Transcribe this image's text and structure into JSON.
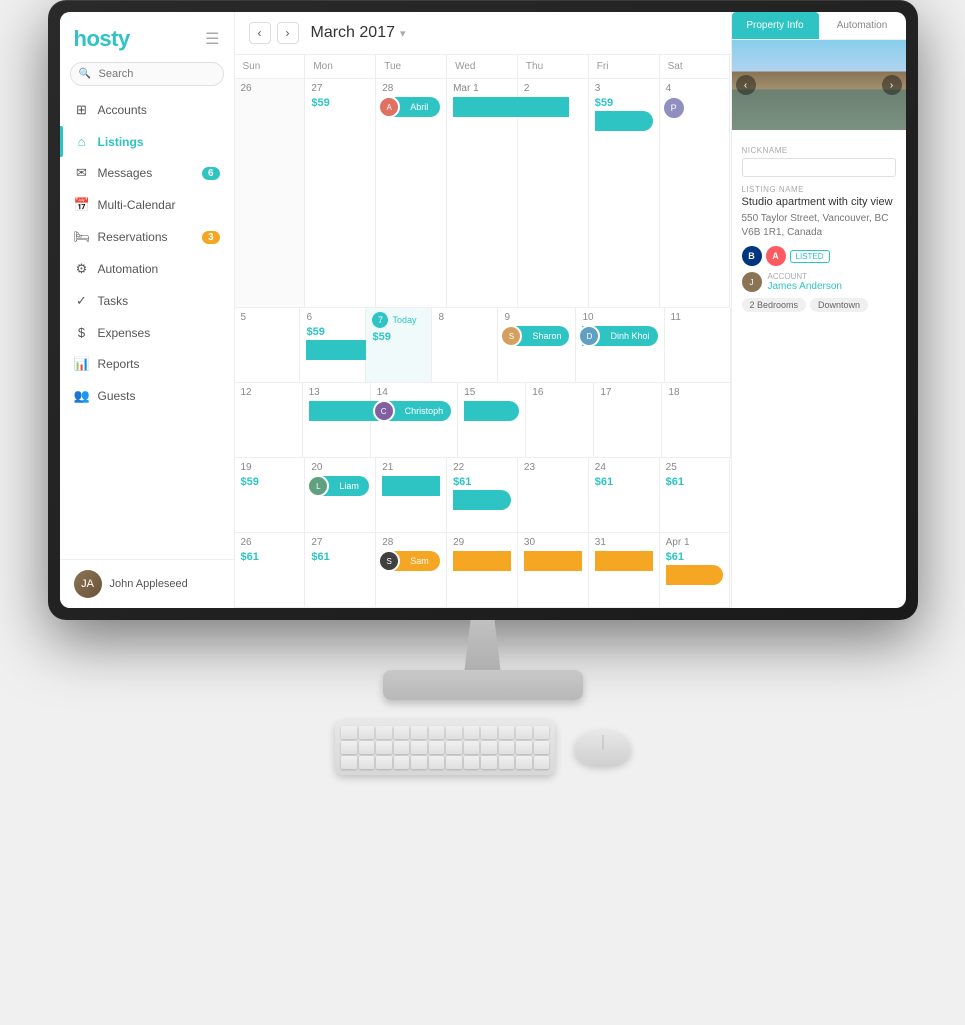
{
  "app": {
    "name": "hosty",
    "title": "Hosty - Property Management"
  },
  "sidebar": {
    "logo": "hosty",
    "search_placeholder": "Search",
    "nav_items": [
      {
        "id": "accounts",
        "label": "Accounts",
        "icon": "accounts",
        "active": false,
        "badge": null
      },
      {
        "id": "listings",
        "label": "Listings",
        "icon": "listings",
        "active": true,
        "badge": null
      },
      {
        "id": "messages",
        "label": "Messages",
        "icon": "messages",
        "active": false,
        "badge": "6"
      },
      {
        "id": "multi-calendar",
        "label": "Multi-Calendar",
        "icon": "calendar",
        "active": false,
        "badge": null
      },
      {
        "id": "reservations",
        "label": "Reservations",
        "icon": "reservations",
        "active": false,
        "badge": "3"
      },
      {
        "id": "automation",
        "label": "Automation",
        "icon": "automation",
        "active": false,
        "badge": null
      },
      {
        "id": "tasks",
        "label": "Tasks",
        "icon": "tasks",
        "active": false,
        "badge": null
      },
      {
        "id": "expenses",
        "label": "Expenses",
        "icon": "expenses",
        "active": false,
        "badge": null
      },
      {
        "id": "reports",
        "label": "Reports",
        "icon": "reports",
        "active": false,
        "badge": null
      },
      {
        "id": "guests",
        "label": "Guests",
        "icon": "guests",
        "active": false,
        "badge": null
      }
    ],
    "user": {
      "name": "John Appleseed",
      "initials": "JA"
    }
  },
  "calendar": {
    "month": "March 2017",
    "day_headers": [
      "Sun",
      "Mon",
      "Tue",
      "Wed",
      "Thu",
      "Fri",
      "Sat"
    ],
    "weeks": [
      {
        "days": [
          {
            "num": "26",
            "other": true,
            "price": null
          },
          {
            "num": "27",
            "other": false,
            "price": "$59"
          },
          {
            "num": "28",
            "other": false,
            "price": null,
            "event": {
              "name": "Abril",
              "color": "teal",
              "avatar": "abril"
            }
          },
          {
            "num": "Mar 1",
            "other": false,
            "price": null,
            "event": {
              "name": "Abril",
              "color": "teal",
              "span": true
            }
          },
          {
            "num": "2",
            "other": false,
            "price": null
          },
          {
            "num": "3",
            "other": false,
            "price": "$59",
            "event": {
              "name": "",
              "color": "teal",
              "span": true
            }
          },
          {
            "num": "4",
            "other": false,
            "price": null,
            "avatar": "person1"
          }
        ]
      },
      {
        "days": [
          {
            "num": "5",
            "other": false,
            "price": null
          },
          {
            "num": "6",
            "other": false,
            "price": "$59",
            "event_bar": true,
            "bar_color": "teal"
          },
          {
            "num": "7",
            "today": true,
            "price": "$59",
            "today_label": "Today"
          },
          {
            "num": "8",
            "other": false,
            "price": null
          },
          {
            "num": "9",
            "other": false,
            "price": null,
            "event": {
              "name": "Sharon",
              "color": "teal",
              "avatar": "sharon"
            }
          },
          {
            "num": "10",
            "other": false,
            "price": null,
            "event": {
              "name": "Dinh Khoi",
              "color": "teal",
              "avatar": "dinhkhoi"
            }
          },
          {
            "num": "11",
            "other": false,
            "price": null
          }
        ]
      },
      {
        "days": [
          {
            "num": "12",
            "other": false,
            "price": null
          },
          {
            "num": "13",
            "other": false,
            "price": null,
            "event_bar": true,
            "bar_color": "teal"
          },
          {
            "num": "14",
            "other": false,
            "price": null,
            "event": {
              "name": "Christoph",
              "color": "teal",
              "avatar": "christoph"
            }
          },
          {
            "num": "15",
            "other": false,
            "price": null,
            "event": {
              "name": "Christoph",
              "color": "teal",
              "span": true
            }
          },
          {
            "num": "16",
            "other": false,
            "price": null
          },
          {
            "num": "17",
            "other": false,
            "price": null
          },
          {
            "num": "18",
            "other": false,
            "price": null
          }
        ]
      },
      {
        "days": [
          {
            "num": "19",
            "other": false,
            "price": "$59"
          },
          {
            "num": "20",
            "other": false,
            "price": null,
            "event": {
              "name": "Liam",
              "color": "teal",
              "avatar": "liam"
            }
          },
          {
            "num": "21",
            "other": false,
            "price": null,
            "event": {
              "name": "Liam",
              "color": "teal",
              "span": true
            }
          },
          {
            "num": "22",
            "other": false,
            "price": "$61",
            "event": {
              "name": "",
              "color": "teal",
              "span": true
            }
          },
          {
            "num": "23",
            "other": false,
            "price": null
          },
          {
            "num": "24",
            "other": false,
            "price": "$61"
          },
          {
            "num": "25",
            "other": false,
            "price": "$61"
          }
        ]
      },
      {
        "days": [
          {
            "num": "26",
            "other": false,
            "price": "$61"
          },
          {
            "num": "27",
            "other": false,
            "price": "$61"
          },
          {
            "num": "28",
            "other": false,
            "price": null,
            "event": {
              "name": "Sam",
              "color": "orange",
              "avatar": "sam"
            }
          },
          {
            "num": "29",
            "other": false,
            "price": null,
            "event": {
              "name": "Sam",
              "color": "orange",
              "span": true
            }
          },
          {
            "num": "30",
            "other": false,
            "price": null,
            "event": {
              "name": "Sam",
              "color": "orange",
              "span": true
            }
          },
          {
            "num": "31",
            "other": false,
            "price": null,
            "event": {
              "name": "Sam",
              "color": "orange",
              "span": true
            }
          },
          {
            "num": "Apr 1",
            "other": false,
            "price": "$61",
            "event": {
              "name": "",
              "color": "orange",
              "span": true
            }
          }
        ]
      }
    ]
  },
  "right_panel": {
    "tabs": [
      {
        "id": "property-info",
        "label": "Property Info",
        "active": true
      },
      {
        "id": "automation",
        "label": "Automation",
        "active": false
      }
    ],
    "nickname_label": "NICKNAME",
    "nickname_value": "",
    "listing_name_label": "LISTING NAME",
    "listing_name": "Studio apartment with city view",
    "address": "550 Taylor Street, Vancouver, BC V6B 1R1, Canada",
    "platforms": [
      "B",
      "A"
    ],
    "listed_badge": "LISTED",
    "account_label": "ACCOUNT",
    "account_name": "James Anderson",
    "tags": [
      "2 Bedrooms",
      "Downtown"
    ]
  },
  "avatars": {
    "abril": "#e07060",
    "sharon": "#d4a060",
    "dinhkhoi": "#60a0c0",
    "christoph": "#8060a0",
    "liam": "#60a080",
    "sam": "#404040",
    "user": "#8B7355"
  }
}
